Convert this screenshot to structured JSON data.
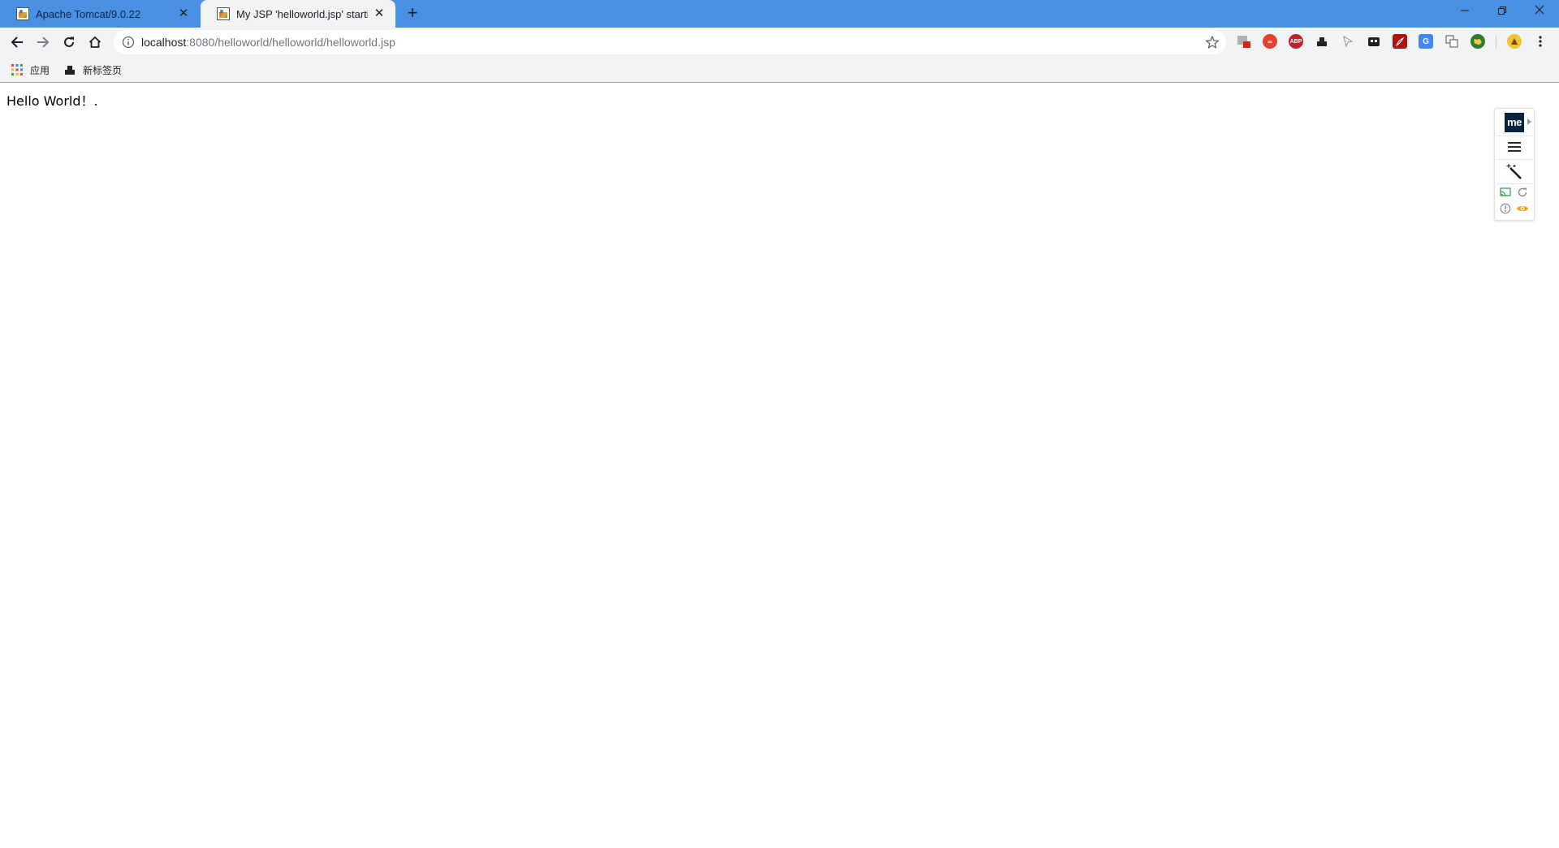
{
  "browser": {
    "tabs": [
      {
        "title": "Apache Tomcat/9.0.22",
        "active": false
      },
      {
        "title": "My JSP 'helloworld.jsp' starting page",
        "active": true
      }
    ],
    "address": {
      "host": "localhost",
      "path": ":8080/helloworld/helloworld/helloworld.jsp"
    },
    "bookmarks": [
      {
        "label": "应用",
        "icon": "apps-grid-icon"
      },
      {
        "label": "新标签页",
        "icon": "new-tab-page-icon"
      }
    ],
    "extensions": [
      "extension-badge-icon",
      "infinity-icon",
      "adblock-plus-icon",
      "bookmark-manager-icon",
      "pointer-icon",
      "extension-puzzle-icon",
      "pdf-icon",
      "google-translate-icon",
      "translate-icon",
      "earth-icon",
      "profile-avatar-icon",
      "menu-more-icon"
    ],
    "colors": {
      "titlebar": "#4a90e2",
      "toolbar": "#f2f3f5"
    }
  },
  "page": {
    "text": "Hello World！."
  },
  "float_panel": {
    "logo": "me"
  }
}
